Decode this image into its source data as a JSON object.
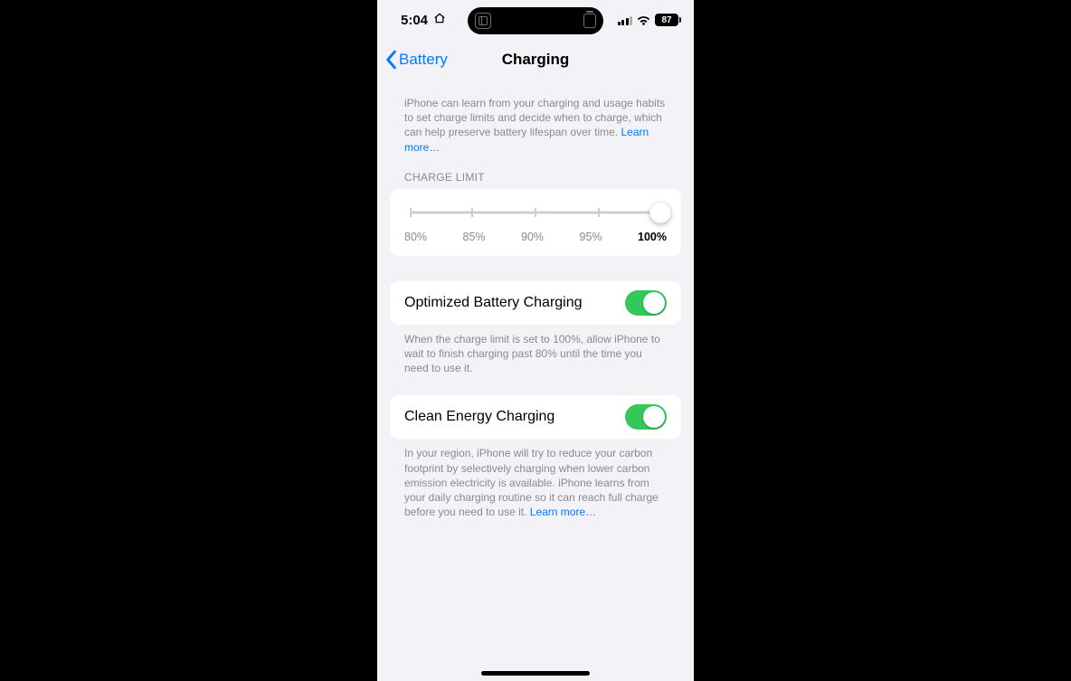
{
  "statusbar": {
    "time": "5:04",
    "battery_percent": "87"
  },
  "nav": {
    "back_label": "Battery",
    "title": "Charging"
  },
  "intro": {
    "text": "iPhone can learn from your charging and usage habits to set charge limits and decide when to charge, which can help preserve battery lifespan over time. ",
    "learn_more": "Learn more…"
  },
  "charge_limit": {
    "header": "CHARGE LIMIT",
    "options": [
      "80%",
      "85%",
      "90%",
      "95%",
      "100%"
    ],
    "selected_index": 4
  },
  "optimized": {
    "title": "Optimized Battery Charging",
    "on": true,
    "footer": "When the charge limit is set to 100%, allow iPhone to wait to finish charging past 80% until the time you need to use it."
  },
  "clean_energy": {
    "title": "Clean Energy Charging",
    "on": true,
    "footer": "In your region, iPhone will try to reduce your carbon footprint by selectively charging when lower carbon emission electricity is available. iPhone learns from your daily charging routine so it can reach full charge before you need to use it. ",
    "learn_more": "Learn more…"
  }
}
